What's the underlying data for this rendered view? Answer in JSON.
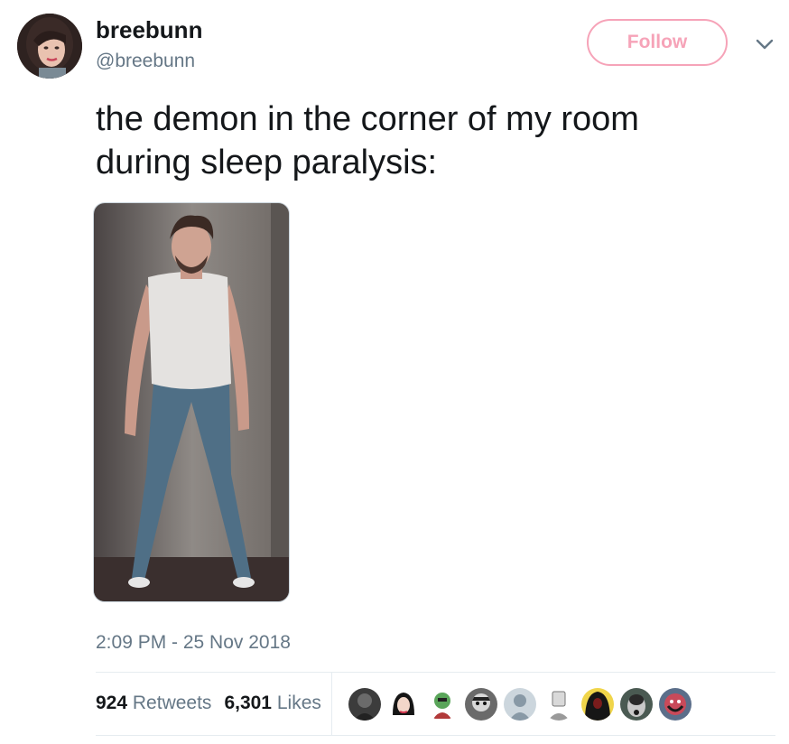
{
  "author": {
    "display_name": "breebunn",
    "handle": "@breebunn",
    "avatar_icon": "profile-photo"
  },
  "follow_button": {
    "label": "Follow",
    "color": "#f6a3b8"
  },
  "menu_icon": "chevron-down-icon",
  "tweet": {
    "text_lines": [
      "the demon in the corner of my room",
      "during sleep paralysis:"
    ],
    "media": "photo of a man standing against a wall"
  },
  "timestamp": "2:09 PM - 25 Nov 2018",
  "stats": {
    "retweets": {
      "count": "924",
      "label": "Retweets"
    },
    "likes": {
      "count": "6,301",
      "label": "Likes"
    }
  },
  "likers": [
    {
      "icon": "liker-avatar-1"
    },
    {
      "icon": "liker-avatar-2"
    },
    {
      "icon": "liker-avatar-3"
    },
    {
      "icon": "liker-avatar-4"
    },
    {
      "icon": "default-avatar-icon"
    },
    {
      "icon": "liker-avatar-6"
    },
    {
      "icon": "liker-avatar-7"
    },
    {
      "icon": "liker-avatar-8"
    },
    {
      "icon": "liker-avatar-9"
    }
  ],
  "colors": {
    "secondary_text": "#657786",
    "primary_text": "#14171a",
    "divider": "#e6ecf0"
  }
}
